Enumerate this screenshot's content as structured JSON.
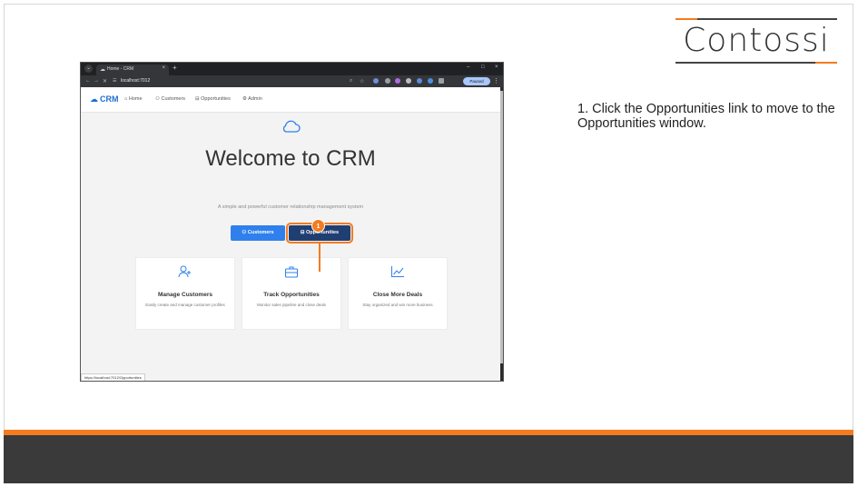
{
  "logo": {
    "text": "Contossi"
  },
  "instruction": {
    "text": "1. Click the Opportunities link to move to the Opportunities window."
  },
  "browser": {
    "tab_title": "Home - CRM",
    "url": "localhost:7012",
    "profile_label": "Paused",
    "status_url": "https://localhost:7012/Opportunities"
  },
  "app": {
    "brand": "CRM",
    "nav": {
      "home": "Home",
      "customers": "Customers",
      "opportunities": "Opportunities",
      "admin": "Admin"
    },
    "hero_title": "Welcome to CRM",
    "hero_subtitle": "A simple and powerful customer relationship management system",
    "buttons": {
      "customers": "Customers",
      "opportunities": "Opportunities"
    },
    "cards": [
      {
        "title": "Manage Customers",
        "desc": "Easily create and manage customer profiles"
      },
      {
        "title": "Track Opportunities",
        "desc": "Monitor sales pipeline and close deals"
      },
      {
        "title": "Close More Deals",
        "desc": "Stay organized and win more business"
      }
    ]
  },
  "callout": {
    "number": "1"
  },
  "colors": {
    "accent": "#f47b20",
    "primary": "#2f80ed",
    "dark_button": "#1f3f73",
    "footer": "#3a3a3a"
  }
}
